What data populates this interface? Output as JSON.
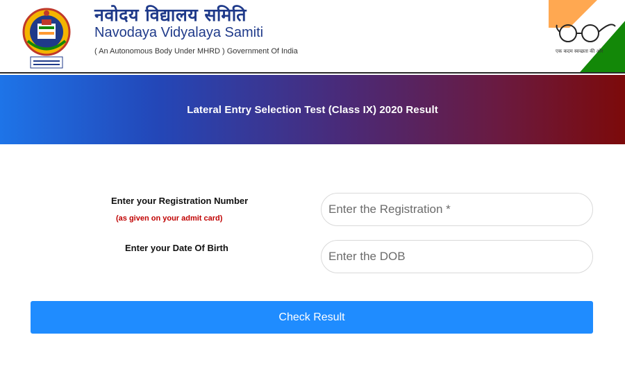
{
  "header": {
    "title_hindi": "नवोदय विद्यालय समिति",
    "title_english": "Navodaya Vidyalaya Samiti",
    "subtitle": "( An Autonomous Body Under MHRD ) Government Of India",
    "logo_icon": "nvs-emblem-icon",
    "right_icon": "swachh-bharat-glasses-icon",
    "gandhi_caption": "एक कदम स्वच्छता की ओर",
    "colors": {
      "saffron": "#ff9933",
      "green": "#138808",
      "brand_blue": "#1f3a8a"
    }
  },
  "banner": {
    "title": "Lateral Entry Selection Test (Class IX) 2020 Result",
    "gradient_start": "#1e74e8",
    "gradient_end": "#7c0a0a"
  },
  "form": {
    "registration_label": "Enter your Registration Number",
    "registration_note": "(as given on your admit card)",
    "registration_placeholder": "Enter the Registration *",
    "dob_label": "Enter your Date Of Birth",
    "dob_placeholder": "Enter the DOB",
    "submit_label": "Check Result",
    "submit_color": "#1f8cff",
    "note_color": "#c00000"
  }
}
